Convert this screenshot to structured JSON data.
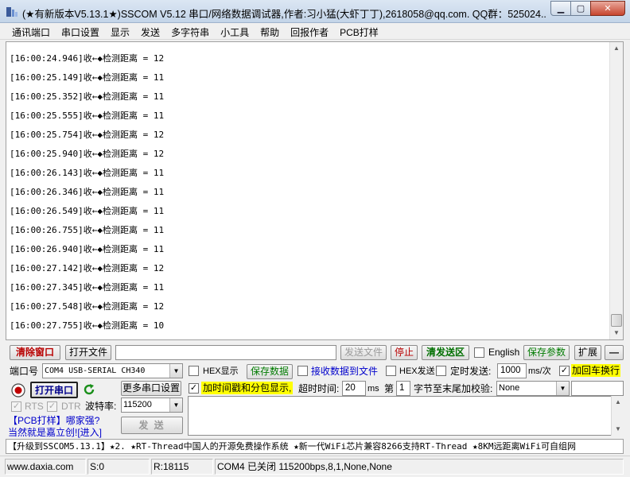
{
  "window": {
    "title": "(★有新版本V5.13.1★)SSCOM V5.12 串口/网络数据调试器,作者:习小猛(大虾丁丁),2618058@qq.com. QQ群：525024..."
  },
  "menu": [
    "通讯端口",
    "串口设置",
    "显示",
    "发送",
    "多字符串",
    "小工具",
    "帮助",
    "回报作者",
    "PCB打样"
  ],
  "log": [
    "[16:00:24.946]收←◆检测距离 = 12",
    "[16:00:25.149]收←◆检测距离 = 11",
    "[16:00:25.352]收←◆检测距离 = 11",
    "[16:00:25.555]收←◆检测距离 = 11",
    "[16:00:25.754]收←◆检测距离 = 12",
    "[16:00:25.940]收←◆检测距离 = 12",
    "[16:00:26.143]收←◆检测距离 = 11",
    "[16:00:26.346]收←◆检测距离 = 11",
    "[16:00:26.549]收←◆检测距离 = 11",
    "[16:00:26.755]收←◆检测距离 = 11",
    "[16:00:26.940]收←◆检测距离 = 11",
    "[16:00:27.142]收←◆检测距离 = 12",
    "[16:00:27.345]收←◆检测距离 = 11",
    "[16:00:27.548]收←◆检测距离 = 12",
    "[16:00:27.755]收←◆检测距离 = 10"
  ],
  "toolbar": {
    "clear": "清除窗口",
    "open_file": "打开文件",
    "file_path": "",
    "send_file": "发送文件",
    "stop": "停止",
    "clear_send": "清发送区",
    "english": "English",
    "save_params": "保存参数",
    "expand": "扩展",
    "collapse": "—"
  },
  "port": {
    "port_label": "端口号",
    "port_value": "COM4 USB-SERIAL CH340",
    "open_port": "打开串口",
    "more_settings": "更多串口设置",
    "rts": "RTS",
    "dtr": "DTR",
    "baud_label": "波特率:",
    "baud_value": "115200",
    "send": "发  送"
  },
  "options": {
    "hex_display": "HEX显示",
    "save_data": "保存数据",
    "recv_to_file": "接收数据到文件",
    "hex_send": "HEX发送",
    "timed_send": "定时发送:",
    "interval": "1000",
    "interval_unit": "ms/次",
    "add_crlf": "加回车换行",
    "timestamp": "加时间戳和分包显示,",
    "timeout_label": "超时时间:",
    "timeout": "20",
    "timeout_unit": "ms",
    "byte_prefix": "第",
    "byte_index": "1",
    "byte_suffix": "字节至末尾加校验:",
    "checksum": "None",
    "send_text": ""
  },
  "promo": {
    "line1_a": "【PCB打样】",
    "line1_b": "哪家强?",
    "line2_a": "当然就是嘉立创!",
    "line2_b": "[进入]"
  },
  "marquee": "【升级到SSCOM5.13.1】★2. ★RT-Thread中国人的开源免费操作系统 ★新一代WiFi芯片兼容8266支持RT-Thread ★8KM远距离WiFi可自组网",
  "status": {
    "site": "www.daxia.com",
    "sent": "S:0",
    "recv": "R:18115",
    "port_state": "COM4 已关闭  115200bps,8,1,None,None"
  },
  "colors": {
    "highlight": "#ffff00",
    "red_text": "#b80000",
    "green_text": "#007a00",
    "link_blue": "#0000cc"
  }
}
